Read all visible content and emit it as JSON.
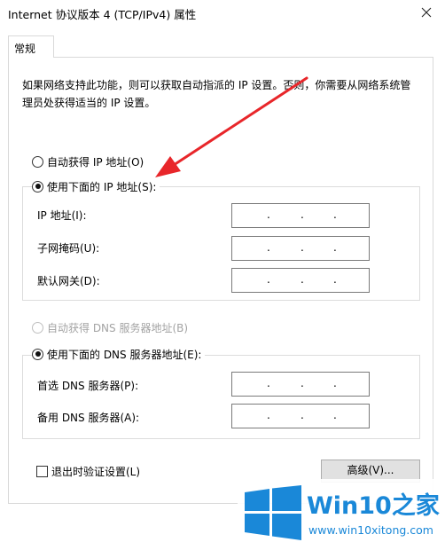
{
  "window": {
    "title": "Internet 协议版本 4 (TCP/IPv4) 属性"
  },
  "tabs": [
    {
      "label": "常规"
    }
  ],
  "general": {
    "description": "如果网络支持此功能，则可以获取自动指派的 IP 设置。否则，你需要从网络系统管理员处获得适当的 IP 设置。",
    "ip_mode": {
      "auto_label": "自动获得 IP 地址(O)",
      "manual_label": "使用下面的 IP 地址(S):",
      "selected": "manual"
    },
    "ip_fields": [
      {
        "label": "IP 地址(I):",
        "value": ". . ."
      },
      {
        "label": "子网掩码(U):",
        "value": ". . ."
      },
      {
        "label": "默认网关(D):",
        "value": ". . ."
      }
    ],
    "dns_mode": {
      "auto_label": "自动获得 DNS 服务器地址(B)",
      "manual_label": "使用下面的 DNS 服务器地址(E):",
      "selected": "manual",
      "auto_disabled": true
    },
    "dns_fields": [
      {
        "label": "首选 DNS 服务器(P):",
        "value": ". . ."
      },
      {
        "label": "备用 DNS 服务器(A):",
        "value": ". . ."
      }
    ],
    "validate_label": "退出时验证设置(L)",
    "validate_checked": false,
    "advanced_button": "高级(V)..."
  },
  "watermark": {
    "brand_prefix": "Win10",
    "brand_suffix": "之家",
    "url": "www.win10xitong.com"
  },
  "colors": {
    "annotation_arrow": "#e8262a",
    "brand_blue": "#1a88d8",
    "disabled_text": "#a3a3a3"
  }
}
